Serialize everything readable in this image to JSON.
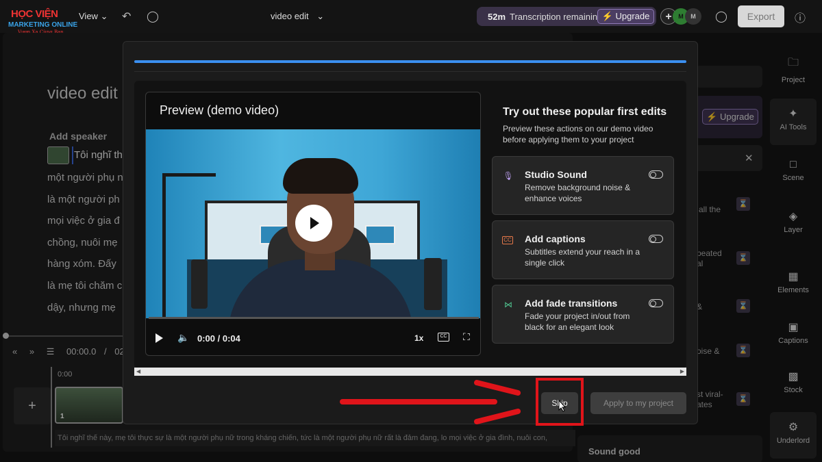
{
  "logo": {
    "line1": "HỌC VIỆN",
    "line2": "MARKETING ONLINE",
    "line3": "Vươn Xa Cùng Bạn"
  },
  "topbar": {
    "view_menu": "View",
    "doc_title": "video edit",
    "transcription_minutes": "52m",
    "transcription_label": "Transcription remaining",
    "upgrade_label": "Upgrade",
    "avatar_initials": [
      "M",
      "M"
    ],
    "export_label": "Export"
  },
  "editor": {
    "title": "video edit",
    "add_speaker": "Add speaker",
    "transcript_lines": [
      "Tôi nghĩ th",
      "một người phụ n",
      "là một người ph",
      "mọi việc ở gia đ",
      "chồng, nuôi mẹ",
      "hàng xóm. Đấy",
      "là mẹ tôi chăm c",
      "dậy, nhưng mẹ"
    ],
    "timecode": "00:00.0",
    "timecode_sep": "/",
    "timecode_end": "02",
    "timeline_start": "0:00",
    "clip_number": "1",
    "caption_strip": "Tôi nghĩ thế này, mẹ tôi thực sự là một người phụ nữ trong kháng chiến, tức là một người phụ nữ rất là đảm đang, lo mọi việc ở gia đình, nuôi con,"
  },
  "right_panel": {
    "upgrade_label": "Upgrade",
    "partial_texts": [
      "all the",
      "peated",
      "al",
      "&",
      "oise &",
      "st viral-",
      "ates"
    ],
    "sound_good": "Sound good"
  },
  "toolbar": {
    "items": [
      {
        "label": "Project",
        "icon": "folder-icon"
      },
      {
        "label": "AI Tools",
        "icon": "sparkle-icon",
        "active": true
      },
      {
        "label": "Scene",
        "icon": "scene-icon"
      },
      {
        "label": "Layer",
        "icon": "layers-icon"
      },
      {
        "label": "Elements",
        "icon": "elements-icon"
      },
      {
        "label": "Captions",
        "icon": "captions-icon"
      },
      {
        "label": "Stock",
        "icon": "stock-icon"
      },
      {
        "label": "Underlord",
        "icon": "robot-icon",
        "active": true
      }
    ]
  },
  "modal": {
    "preview_title": "Preview (demo video)",
    "time_current": "0:00",
    "time_total": "0:04",
    "speed": "1x",
    "cc": "CC",
    "heading": "Try out these popular first edits",
    "subheading": "Preview these actions on our demo video before applying them to your project",
    "options": [
      {
        "title": "Studio Sound",
        "desc": "Remove background noise & enhance voices",
        "icon": "studio-sound-icon",
        "color": "#b79be8"
      },
      {
        "title": "Add captions",
        "desc": "Subtitles extend your reach in a single click",
        "icon": "captions-icon",
        "color": "#e8794a"
      },
      {
        "title": "Add fade transitions",
        "desc": "Fade your project in/out from black for an elegant look",
        "icon": "transition-icon",
        "color": "#4fc08d"
      }
    ],
    "skip_label": "Skip",
    "apply_label": "Apply to my project"
  },
  "colors": {
    "accent_blue": "#3b8ff0",
    "annotation_red": "#e0141a",
    "upgrade_purple": "#8f7ab8"
  }
}
